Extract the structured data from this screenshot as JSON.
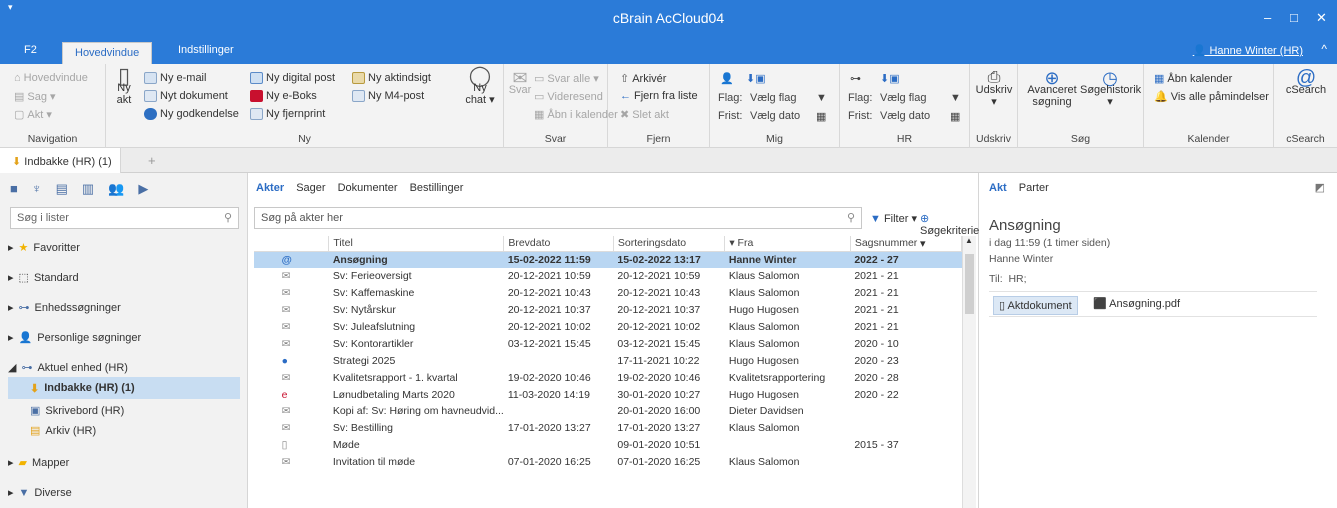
{
  "window": {
    "title": "cBrain AcCloud04",
    "min": "–",
    "max": "□",
    "close": "✕"
  },
  "ribbon_tabs": {
    "f2": "F2",
    "hoved": "Hovedvindue",
    "indst": "Indstillinger",
    "user": "Hanne Winter (HR)",
    "collapse": "^"
  },
  "navigation": {
    "hovedvindue": "Hovedvindue",
    "sag": "Sag ▾",
    "akt": "Akt ▾",
    "label": "Navigation"
  },
  "ny": {
    "email": "Ny e-mail",
    "dokument": "Nyt dokument",
    "godkendelse": "Ny godkendelse",
    "ny_akt_top": "Ny",
    "ny_akt_bot": "akt",
    "digital": "Ny digital post",
    "eboks": "Ny e-Boks",
    "fjernprint": "Ny fjernprint",
    "aktindsigt": "Ny aktindsigt",
    "m4": "Ny M4-post",
    "chat_top": "Ny",
    "chat_bot": "chat ▾",
    "label": "Ny"
  },
  "svar": {
    "svar": "Svar",
    "svaralle": "Svar alle ▾",
    "videresend": "Videresend",
    "kalender": "Åbn i kalender",
    "label": "Svar"
  },
  "fjern": {
    "arkiver": "Arkivér",
    "fjernliste": "Fjern fra liste",
    "slet": "Slet akt",
    "label": "Fjern"
  },
  "mig": {
    "flag_lbl": "Flag:",
    "flag_val": "Vælg flag",
    "frist_lbl": "Frist:",
    "frist_val": "Vælg dato",
    "label": "Mig"
  },
  "hr": {
    "flag_lbl": "Flag:",
    "flag_val": "Vælg flag",
    "frist_lbl": "Frist:",
    "frist_val": "Vælg dato",
    "label": "HR"
  },
  "udskriv": {
    "btn": "Udskriv",
    "label": "Udskriv"
  },
  "sog": {
    "avanceret": "Avanceret",
    "sogning": "søgning",
    "historik": "Søgehistorik",
    "label": "Søg"
  },
  "kalender": {
    "aabn": "Åbn kalender",
    "paamind": "Vis alle påmindelser",
    "label": "Kalender"
  },
  "csearch": {
    "btn": "cSearch",
    "label": "cSearch"
  },
  "doctab": {
    "label": "Indbakke (HR) (1)",
    "add": "+"
  },
  "left": {
    "search_placeholder": "Søg i lister",
    "favoritter": "Favoritter",
    "standard": "Standard",
    "enhed": "Enhedssøgninger",
    "personlige": "Personlige søgninger",
    "aktuel": "Aktuel enhed (HR)",
    "indbakke": "Indbakke (HR) (1)",
    "skrivebord": "Skrivebord (HR)",
    "arkiv": "Arkiv (HR)",
    "mapper": "Mapper",
    "diverse": "Diverse"
  },
  "mid": {
    "tabs": [
      "Akter",
      "Sager",
      "Dokumenter",
      "Bestillinger"
    ],
    "search_placeholder": "Søg på akter her",
    "filter": "Filter ▾",
    "kriterier": "Søgekriterier ▾",
    "headers": [
      "Titel",
      "Brevdato",
      "Sorteringsdato",
      "▾ Fra",
      "Sagsnummer"
    ],
    "rows": [
      {
        "t": "Ansøgning",
        "b": "15-02-2022 11:59",
        "s": "15-02-2022 13:17",
        "f": "Hanne Winter",
        "n": "2022 - 27"
      },
      {
        "t": "Sv: Ferieoversigt",
        "b": "20-12-2021 10:59",
        "s": "20-12-2021 10:59",
        "f": "Klaus Salomon",
        "n": "2021 - 21"
      },
      {
        "t": "Sv: Kaffemaskine",
        "b": "20-12-2021 10:43",
        "s": "20-12-2021 10:43",
        "f": "Klaus Salomon",
        "n": "2021 - 21"
      },
      {
        "t": "Sv: Nytårskur",
        "b": "20-12-2021 10:37",
        "s": "20-12-2021 10:37",
        "f": "Hugo Hugosen",
        "n": "2021 - 21"
      },
      {
        "t": "Sv: Juleafslutning",
        "b": "20-12-2021 10:02",
        "s": "20-12-2021 10:02",
        "f": "Klaus Salomon",
        "n": "2021 - 21"
      },
      {
        "t": "Sv: Kontorartikler",
        "b": "03-12-2021 15:45",
        "s": "03-12-2021 15:45",
        "f": "Klaus Salomon",
        "n": "2020 - 10"
      },
      {
        "t": "Strategi 2025",
        "b": "",
        "s": "17-11-2021 10:22",
        "f": "Hugo Hugosen",
        "n": "2020 - 23"
      },
      {
        "t": "Kvalitetsrapport - 1. kvartal",
        "b": "19-02-2020 10:46",
        "s": "19-02-2020 10:46",
        "f": "Kvalitetsrapportering",
        "n": "2020 - 28"
      },
      {
        "t": "Lønudbetaling Marts 2020",
        "b": "11-03-2020 14:19",
        "s": "30-01-2020 10:27",
        "f": "Hugo Hugosen",
        "n": "2020 - 22"
      },
      {
        "t": "Kopi af: Sv: Høring om havneudvid...",
        "b": "",
        "s": "20-01-2020 16:00",
        "f": "Dieter Davidsen",
        "n": ""
      },
      {
        "t": "Sv: Bestilling",
        "b": "17-01-2020 13:27",
        "s": "17-01-2020 13:27",
        "f": "Klaus Salomon",
        "n": ""
      },
      {
        "t": "Møde",
        "b": "",
        "s": "09-01-2020 10:51",
        "f": "",
        "n": "2015 - 37"
      },
      {
        "t": "Invitation til møde",
        "b": "07-01-2020 16:25",
        "s": "07-01-2020 16:25",
        "f": "Klaus Salomon",
        "n": ""
      }
    ]
  },
  "right": {
    "tab_akt": "Akt",
    "tab_parter": "Parter",
    "title": "Ansøgning",
    "time": "i dag 11:59 (1 timer siden)",
    "from": "Hanne Winter",
    "til_lbl": "Til:",
    "til_val": "HR;",
    "aktdok": "Aktdokument",
    "pdf": "Ansøgning.pdf"
  }
}
